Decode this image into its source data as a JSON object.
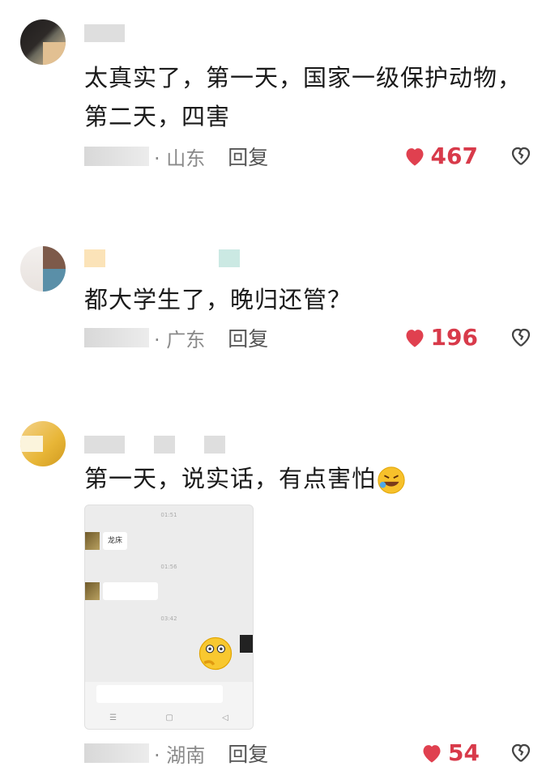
{
  "comments": [
    {
      "text_line1": "太真实了，第一天，国家一级保护动物，",
      "text_line2": "第二天，四害",
      "location": "· 山东",
      "reply_label": "回复",
      "likes": "467"
    },
    {
      "text_line1": "都大学生了，晚归还管？",
      "location": "· 广东",
      "reply_label": "回复",
      "likes": "196"
    },
    {
      "text_line1": "第一天，说实话，有点害怕",
      "location": "· 湖南",
      "reply_label": "回复",
      "likes": "54",
      "attachment": {
        "bubble_text": "龙床"
      }
    }
  ],
  "icons": {
    "heart": "heart-icon",
    "dislike": "broken-heart-icon",
    "laugh_emoji": "rolling-laugh-emoji",
    "thinking_emoji": "thinking-emoji"
  },
  "colors": {
    "like": "#d83a4a",
    "meta": "#8a8a8a"
  }
}
